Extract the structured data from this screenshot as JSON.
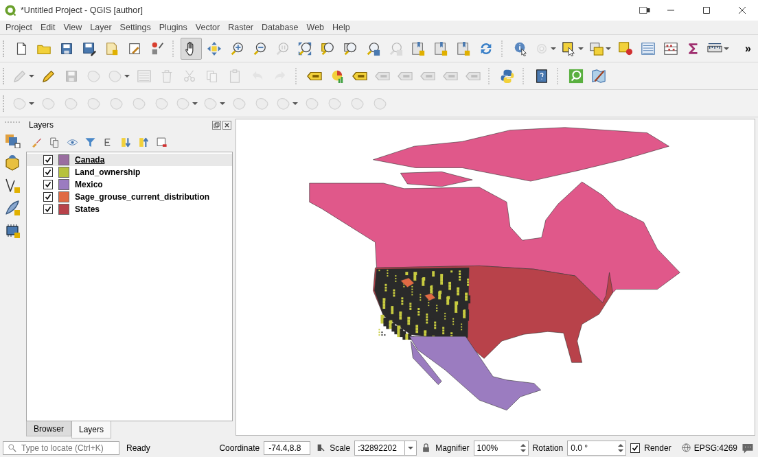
{
  "window": {
    "title": "*Untitled Project - QGIS [author]"
  },
  "menu": [
    "Project",
    "Edit",
    "View",
    "Layer",
    "Settings",
    "Plugins",
    "Vector",
    "Raster",
    "Database",
    "Web",
    "Help"
  ],
  "toolbars": [
    {
      "items": [
        {
          "disabled": false,
          "pressed": false
        },
        {
          "disabled": false,
          "pressed": false
        },
        {
          "disabled": false,
          "pressed": false
        },
        {
          "disabled": false,
          "pressed": false
        },
        {
          "disabled": false,
          "pressed": false
        },
        {
          "disabled": false,
          "pressed": false
        },
        {
          "disabled": false,
          "pressed": false
        },
        {
          "disabled": false,
          "pressed": true
        },
        {
          "disabled": false,
          "pressed": false
        },
        {
          "disabled": false,
          "pressed": false
        },
        {
          "disabled": false,
          "pressed": false
        },
        {
          "disabled": true,
          "pressed": false
        },
        {
          "disabled": false,
          "pressed": false
        },
        {
          "disabled": false,
          "pressed": false
        },
        {
          "disabled": false,
          "pressed": false
        },
        {
          "disabled": false,
          "pressed": false
        },
        {
          "disabled": true,
          "pressed": false
        },
        {
          "disabled": false,
          "pressed": false
        },
        {
          "disabled": false,
          "pressed": false
        },
        {
          "disabled": false,
          "pressed": false
        },
        {
          "disabled": false,
          "pressed": false
        },
        {
          "disabled": false,
          "pressed": false
        },
        {
          "disabled": true,
          "pressed": false
        },
        {
          "disabled": false,
          "pressed": false
        },
        {
          "disabled": false,
          "pressed": false
        },
        {
          "disabled": false,
          "pressed": false
        },
        {
          "disabled": false,
          "pressed": false
        },
        {
          "disabled": false,
          "pressed": false
        },
        {
          "disabled": false,
          "pressed": false
        },
        {
          "disabled": false,
          "pressed": false
        }
      ],
      "overflow": "»"
    },
    {
      "items": [
        {
          "disabled": true,
          "pressed": false
        },
        {
          "disabled": false,
          "pressed": false
        },
        {
          "disabled": true,
          "pressed": false
        },
        {
          "disabled": true,
          "pressed": false
        },
        {
          "disabled": true,
          "pressed": false
        },
        {
          "disabled": true,
          "pressed": false
        },
        {
          "disabled": true,
          "pressed": false
        },
        {
          "disabled": true,
          "pressed": false
        },
        {
          "disabled": true,
          "pressed": false
        },
        {
          "disabled": true,
          "pressed": false
        },
        {
          "disabled": true,
          "pressed": false
        },
        {
          "disabled": true,
          "pressed": false
        },
        {
          "disabled": false,
          "pressed": false
        },
        {
          "disabled": false,
          "pressed": false
        },
        {
          "disabled": false,
          "pressed": false
        },
        {
          "disabled": true,
          "pressed": false
        },
        {
          "disabled": true,
          "pressed": false
        },
        {
          "disabled": true,
          "pressed": false
        },
        {
          "disabled": true,
          "pressed": false
        },
        {
          "disabled": true,
          "pressed": false
        },
        {
          "disabled": false,
          "pressed": false
        },
        {
          "disabled": false,
          "pressed": false
        },
        {
          "disabled": false,
          "pressed": false
        },
        {
          "disabled": false,
          "pressed": false
        }
      ]
    },
    {
      "items": [
        {
          "disabled": true,
          "pressed": false
        },
        {
          "disabled": true,
          "pressed": false
        },
        {
          "disabled": true,
          "pressed": false
        },
        {
          "disabled": true,
          "pressed": false
        },
        {
          "disabled": true,
          "pressed": false
        },
        {
          "disabled": true,
          "pressed": false
        },
        {
          "disabled": true,
          "pressed": false
        },
        {
          "disabled": true,
          "pressed": false
        },
        {
          "disabled": true,
          "pressed": false
        },
        {
          "disabled": true,
          "pressed": false
        },
        {
          "disabled": true,
          "pressed": false
        },
        {
          "disabled": true,
          "pressed": false
        },
        {
          "disabled": true,
          "pressed": false
        },
        {
          "disabled": true,
          "pressed": false
        },
        {
          "disabled": true,
          "pressed": false
        },
        {
          "disabled": true,
          "pressed": false
        }
      ]
    }
  ],
  "layers_panel": {
    "title": "Layers",
    "layers": [
      {
        "name": "Canada",
        "checked": true,
        "selected": true,
        "color": "#9a6ea0"
      },
      {
        "name": "Land_ownership",
        "checked": true,
        "selected": false,
        "color": "#b6c23c"
      },
      {
        "name": "Mexico",
        "checked": true,
        "selected": false,
        "color": "#9b7cc0"
      },
      {
        "name": "Sage_grouse_current_distribution",
        "checked": true,
        "selected": false,
        "color": "#e06a44"
      },
      {
        "name": "States",
        "checked": true,
        "selected": false,
        "color": "#b8424a"
      }
    ],
    "tabs": [
      {
        "label": "Browser",
        "selected": false
      },
      {
        "label": "Layers",
        "selected": true
      }
    ]
  },
  "status_bar": {
    "locator_placeholder": "Type to locate (Ctrl+K)",
    "message": "Ready",
    "coordinate_label": "Coordinate",
    "coordinate": "-74.4,8.8",
    "scale_label": "Scale",
    "scale": ":32892202",
    "magnifier_label": "Magnifier",
    "magnifier": "100%",
    "rotation_label": "Rotation",
    "rotation": "0.0 °",
    "render_label": "Render",
    "render": true,
    "crs": "EPSG:4269"
  }
}
